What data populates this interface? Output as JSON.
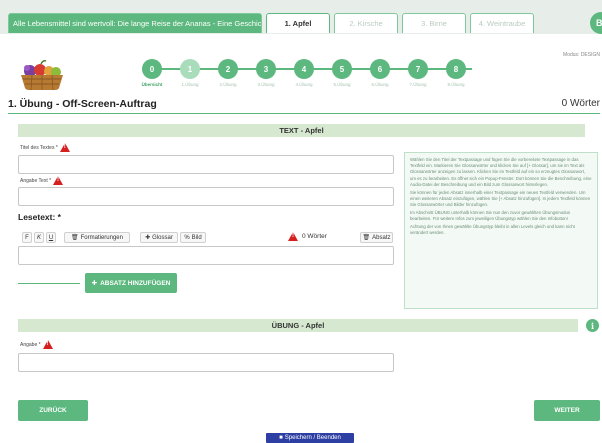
{
  "tabs": [
    {
      "label": "Alle Lebensmittel sind wertvoll: Die lange Reise der Ananas - Eine Geschichte"
    },
    {
      "label": "1. Apfel"
    },
    {
      "label": "2. Kirsche"
    },
    {
      "label": "3. Birne"
    },
    {
      "label": "4. Weintraube"
    }
  ],
  "user": {
    "initial": "B"
  },
  "modus": "Modus: DESIGN",
  "progress": {
    "steps": [
      {
        "number": "0",
        "label": "Übersicht"
      },
      {
        "number": "1",
        "label": "1.Übung"
      },
      {
        "number": "2",
        "label": "2.Übung"
      },
      {
        "number": "3",
        "label": "3.Übung"
      },
      {
        "number": "4",
        "label": "4.Übung"
      },
      {
        "number": "5",
        "label": "5.Übung"
      },
      {
        "number": "6",
        "label": "6.Übung"
      },
      {
        "number": "7",
        "label": "7.Übung"
      },
      {
        "number": "8",
        "label": "8.Übung"
      }
    ],
    "current_step": 1
  },
  "page": {
    "title": "1. Übung - Off-Screen-Auftrag",
    "word_count": "0 Wörter"
  },
  "text_section": {
    "title": "TEXT - Apfel",
    "title_label": "Titel des Textes *",
    "title_value": "",
    "info_label": "Angabe Text *",
    "info_value": "",
    "lesetext_label": "Lesetext: *",
    "toolbar": {
      "bold": "F",
      "italic": "K",
      "underline": "U",
      "format": "Formatierungen",
      "glossar": "Glossar",
      "bild": "Bild",
      "words": "0 Wörter",
      "absatz": "Absatz"
    },
    "paragraph_value": "",
    "add_paragraph": "ABSATZ HINZUFÜGEN"
  },
  "info_text": [
    "Wählen Sie den Titel der Textpassage und fügen Sie die vorbereitete Textpassage in das Textfeld ein. Markieren Sie Glossarwörter und klicken Sie auf [+ Glossar], um sie im Text als Glossarwörter anzeigen zu lassen. Klicken Sie im Textfeld auf ein so erzeugtes Glossarwort, um es zu bearbeiten. Es öffnet sich ein Popup-Fenster. Dort können Sie die Beschreibung, eine Audio-Datei der Beschreibung und ein Bild zum Glossarwort hinterlegen.",
    "Sie können für jeden Absatz innerhalb einer Textpassage ein neues Textfeld verwenden. Um einen weiteren Absatz einzufügen, wählen Sie [+ Absatz hinzufügen]. In jedem Textfeld können Sie Glossarwörter und Bilder hinzufügen.",
    "Im Abschnitt ÜBUNG unterhalb können Sie nun den zuvor gewählten Übungsmodus bearbeiten. Für weitere Infos zum jeweiligen Übungstyp wählen Sie den Infobutton!",
    "Achtung der von Ihnen gewählte Übungstyp bleibt in allen Levels gleich und kann nicht verändert werden."
  ],
  "exercise_section": {
    "title": "ÜBUNG - Apfel",
    "info_label": "Angabe *",
    "info_value": ""
  },
  "nav": {
    "back": "ZURÜCK",
    "next": "WEITER",
    "save": "Speichern / Beenden"
  },
  "colors": {
    "accent": "#5cb87e",
    "section_bar": "#d6e9d0",
    "warning": "#d62020",
    "save_button": "#2d3fa2"
  }
}
